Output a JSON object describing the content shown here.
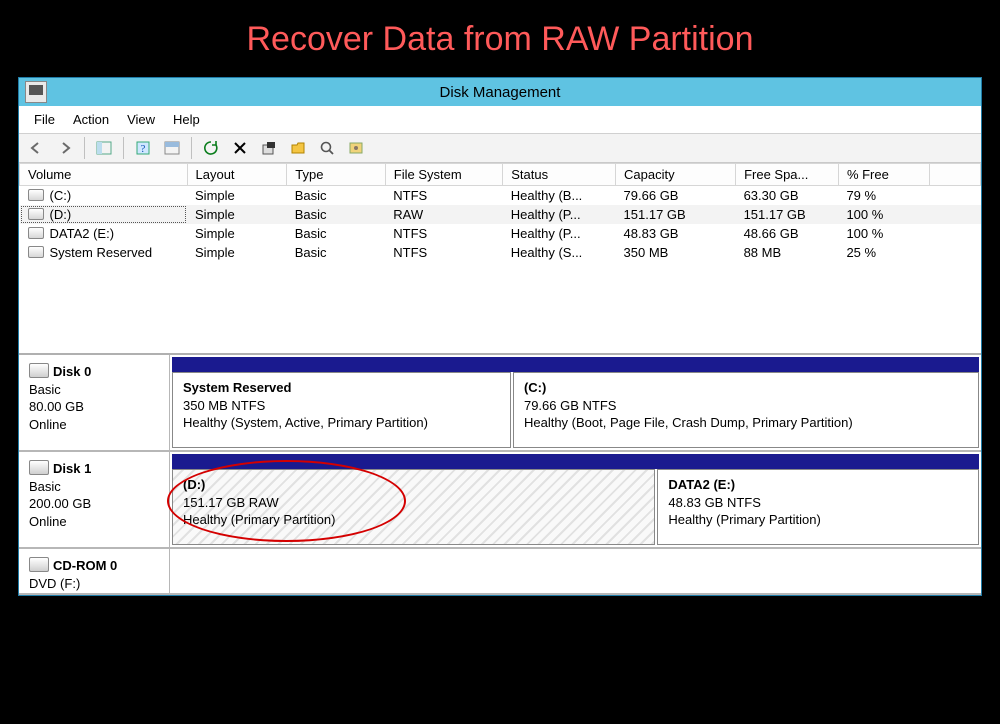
{
  "page_title": "Recover Data from RAW Partition",
  "window": {
    "title": "Disk Management"
  },
  "menubar": [
    "File",
    "Action",
    "View",
    "Help"
  ],
  "columns": [
    "Volume",
    "Layout",
    "Type",
    "File System",
    "Status",
    "Capacity",
    "Free Spa...",
    "% Free"
  ],
  "volumes": [
    {
      "name": "(C:)",
      "layout": "Simple",
      "type": "Basic",
      "fs": "NTFS",
      "status": "Healthy (B...",
      "capacity": "79.66 GB",
      "free": "63.30 GB",
      "pct": "79 %"
    },
    {
      "name": "(D:)",
      "layout": "Simple",
      "type": "Basic",
      "fs": "RAW",
      "status": "Healthy (P...",
      "capacity": "151.17 GB",
      "free": "151.17 GB",
      "pct": "100 %",
      "selected": true
    },
    {
      "name": "DATA2 (E:)",
      "layout": "Simple",
      "type": "Basic",
      "fs": "NTFS",
      "status": "Healthy (P...",
      "capacity": "48.83 GB",
      "free": "48.66 GB",
      "pct": "100 %"
    },
    {
      "name": "System Reserved",
      "layout": "Simple",
      "type": "Basic",
      "fs": "NTFS",
      "status": "Healthy (S...",
      "capacity": "350 MB",
      "free": "88 MB",
      "pct": "25 %"
    }
  ],
  "disks": [
    {
      "name": "Disk 0",
      "type": "Basic",
      "size": "80.00 GB",
      "status": "Online",
      "parts": [
        {
          "title": "System Reserved",
          "line2": "350 MB NTFS",
          "line3": "Healthy (System, Active, Primary Partition)",
          "grow": 1
        },
        {
          "title": "(C:)",
          "line2": "79.66 GB NTFS",
          "line3": "Healthy (Boot, Page File, Crash Dump, Primary Partition)",
          "grow": 1.6
        }
      ]
    },
    {
      "name": "Disk 1",
      "type": "Basic",
      "size": "200.00 GB",
      "status": "Online",
      "parts": [
        {
          "title": "(D:)",
          "line2": "151.17 GB RAW",
          "line3": "Healthy (Primary Partition)",
          "grow": 2.1,
          "raw": true,
          "circled": true
        },
        {
          "title": "DATA2  (E:)",
          "line2": "48.83 GB NTFS",
          "line3": "Healthy (Primary Partition)",
          "grow": 1
        }
      ]
    },
    {
      "name": "CD-ROM 0",
      "type": "DVD (F:)",
      "size": "",
      "status": "",
      "parts": [],
      "short": true
    }
  ]
}
